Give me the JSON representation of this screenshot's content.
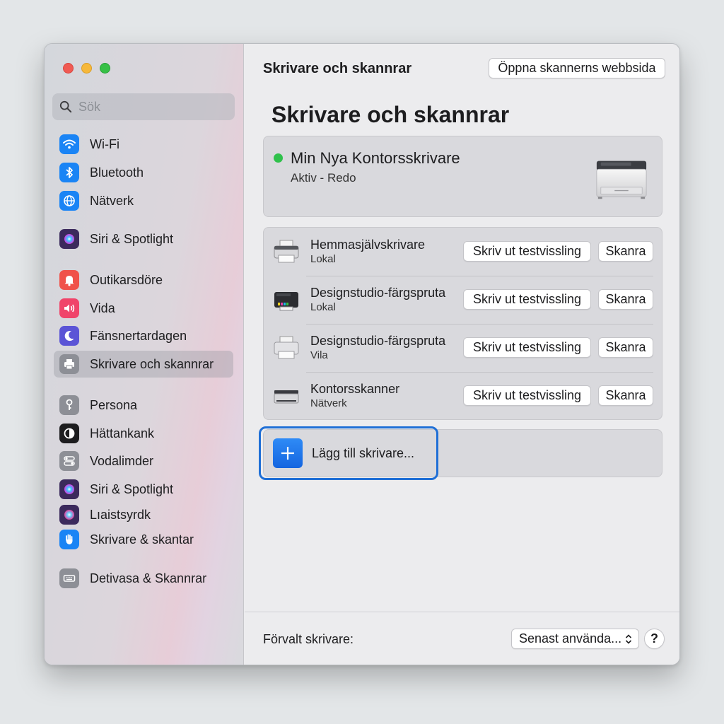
{
  "sidebar": {
    "search": {
      "placeholder": "Sök"
    },
    "items": [
      {
        "label": "Wi-Fi",
        "icon": "wifi-icon",
        "color": "#1a84f5"
      },
      {
        "label": "Bluetooth",
        "icon": "bluetooth-icon",
        "color": "#1a84f5"
      },
      {
        "label": "Nätverk",
        "icon": "globe-icon",
        "color": "#1a84f5"
      },
      {
        "label": "Siri & Spotlight",
        "icon": "siri-icon",
        "color": "#3b2a5c"
      },
      {
        "label": "Outikarsdöre",
        "icon": "notification-icon",
        "color": "#f0514a"
      },
      {
        "label": "Vida",
        "icon": "speaker-icon",
        "color": "#f0446a"
      },
      {
        "label": "Fänsnertardagen",
        "icon": "moon-icon",
        "color": "#5b54d6"
      },
      {
        "label": "Skrivare och skannrar",
        "icon": "printer-icon",
        "color": "#8d8f96",
        "selected": true
      },
      {
        "label": "Persona",
        "icon": "key-icon",
        "color": "#8d8f96"
      },
      {
        "label": "Hättankank",
        "icon": "contrast-icon",
        "color": "#1d1d1f"
      },
      {
        "label": "Vodalimder",
        "icon": "toggle-icon",
        "color": "#8d8f96"
      },
      {
        "label": "Siri & Spotlight",
        "icon": "siri-icon",
        "color": "#3b2a5c"
      },
      {
        "label": "Lıaistsyrdk",
        "icon": "siri-icon",
        "color": "#3b2a5c"
      },
      {
        "label": "Skrivare & skantar",
        "icon": "hand-icon",
        "color": "#1a84f5"
      },
      {
        "label": "Detivasa & Skannrar",
        "icon": "keyboard-icon",
        "color": "#8d8f96"
      }
    ]
  },
  "main": {
    "toolbar_title": "Skrivare och skannrar",
    "open_web_label": "Öppna skannerns webbsida",
    "page_title": "Skrivare och skannrar",
    "default_printer": {
      "name": "Min Nya Kontorsskrivare",
      "status": "Aktiv - Redo",
      "status_color": "#2fc14b"
    },
    "printers": [
      {
        "name": "Hemmasjälvskrivare",
        "sub": "Lokal",
        "icon": "printer-icon",
        "test_label": "Skriv ut testvissling",
        "scan_label": "Skanra"
      },
      {
        "name": "Designstudio-färgspruta",
        "sub": "Lokal",
        "icon": "inkjet-printer-icon",
        "test_label": "Skriv ut testvissling",
        "scan_label": "Skanra"
      },
      {
        "name": "Designstudio-färgspruta",
        "sub": "Vila",
        "icon": "printer-icon",
        "test_label": "Skriv ut testvissling",
        "scan_label": "Skanra"
      },
      {
        "name": "Kontorsskanner",
        "sub": "Nätverk",
        "icon": "scanner-icon",
        "test_label": "Skriv ut testvissling",
        "scan_label": "Skanra"
      }
    ],
    "add_label": "Lägg till skrivare...",
    "accent": "#1f6fd6"
  },
  "footer": {
    "label": "Förvalt skrivare:",
    "select_value": "Senast använda...",
    "help_label": "?"
  }
}
